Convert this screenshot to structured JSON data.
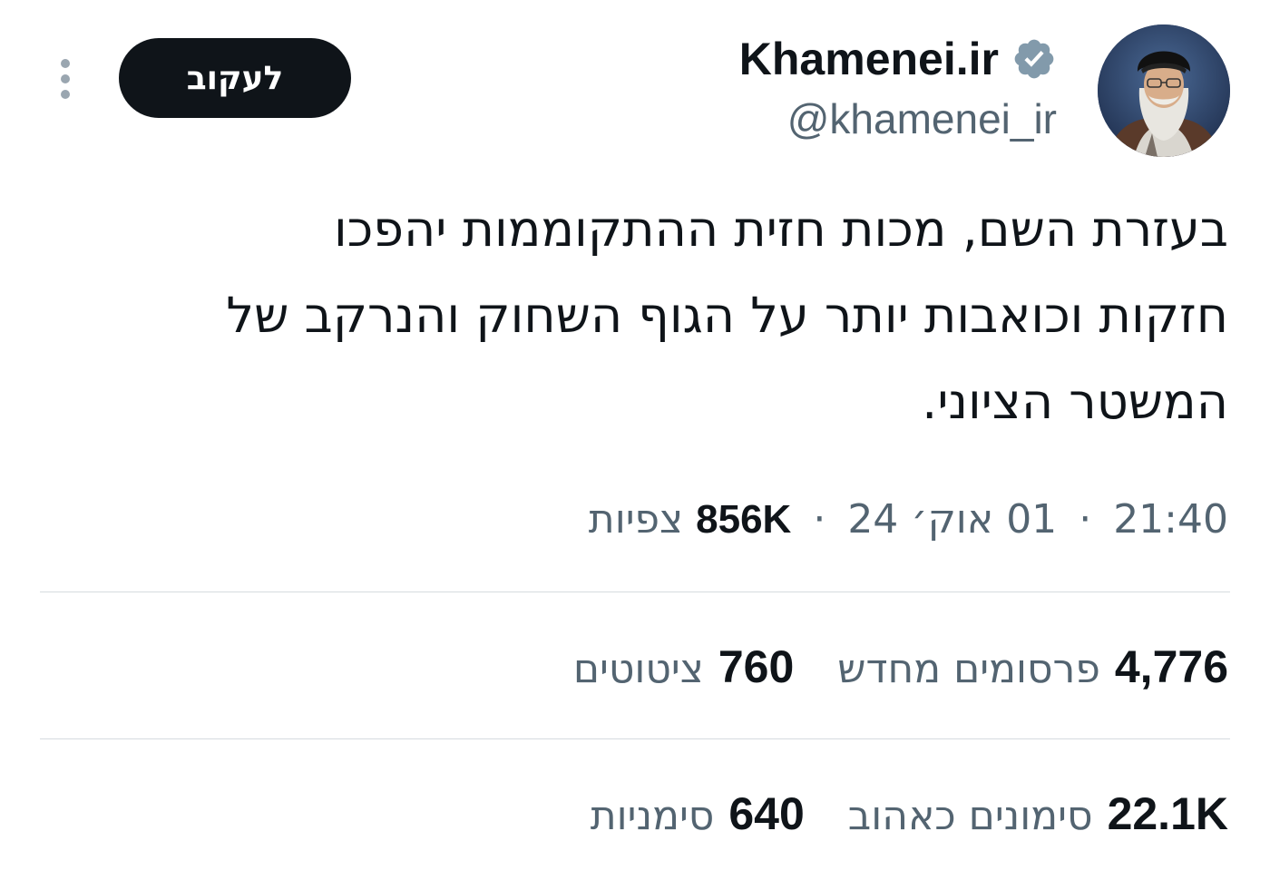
{
  "author": {
    "display_name": "Khamenei.ir",
    "handle": "@khamenei_ir",
    "verified_icon": "verified-badge-icon",
    "avatar": "avatar-photo"
  },
  "follow_button": {
    "label": "לעקוב"
  },
  "more_menu": {
    "icon": "more-vertical-icon"
  },
  "tweet": {
    "lines": [
      "בעזרת השם, מכות חזית ההתקוממות יהפכו",
      "חזקות וכואבות יותר על הגוף השחוק והנרקב של",
      "המשטר הציוני."
    ]
  },
  "meta": {
    "time": "21:40",
    "separator": "·",
    "date": "01 אוק׳ 24",
    "views_count": "856K",
    "views_label": "צפיות"
  },
  "stats": {
    "reposts": {
      "count": "4,776",
      "label": "פרסומים מחדש"
    },
    "quotes": {
      "count": "760",
      "label": "ציטוטים"
    },
    "likes": {
      "count": "22.1K",
      "label": "סימונים כאהוב"
    },
    "bookmarks": {
      "count": "640",
      "label": "סימניות"
    }
  },
  "colors": {
    "text_primary": "#0f1419",
    "text_secondary": "#536471",
    "button_bg": "#0f1419",
    "verified_badge": "#829aab",
    "divider": "#d6dbdf"
  }
}
